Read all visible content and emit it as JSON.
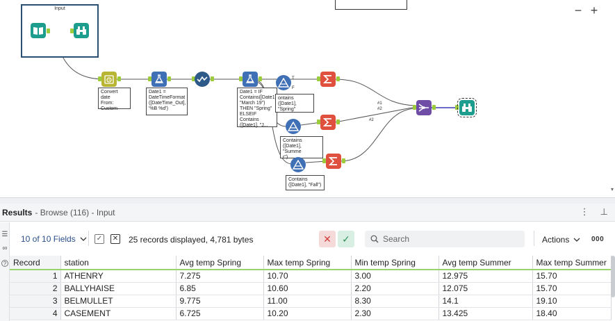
{
  "canvas": {
    "container_title": "Input",
    "zoom_out": "−",
    "zoom_in": "+",
    "annotations": {
      "formula": "Convert date\nFrom:\nCustom",
      "datetime": "Date1 =\nDateTimeFormat\n([DateTime_Out],\n'%B %d')",
      "season": "Date1 = IF\nContains([Date1],\n\"March 19\")\nTHEN \"Spring\"\nELSEIF Contains\n([Date1], \"J...",
      "filter_spring": "ontains\n([Date1], \"Spring\"",
      "filter_summer": "Contains\n([Date1], \"Summe\nr\")",
      "filter_fall": "Contains\n([Date1], \"Fall\")"
    },
    "input_labels": {
      "in1": "#1",
      "in2": "#2",
      "in2b": "#2"
    }
  },
  "results": {
    "title": "Results",
    "subtitle": "- Browse (116) - Input",
    "more_icon": "⋮",
    "pin_icon": "⊥"
  },
  "toolbar": {
    "fields_label": "10 of 10 Fields",
    "records_text": "25 records displayed, 4,781 bytes",
    "search_placeholder": "Search",
    "actions_label": "Actions",
    "more_label": "000"
  },
  "table": {
    "columns": [
      "Record",
      "station",
      "Avg temp Spring",
      "Max temp Spring",
      "Min temp Spring",
      "Avg temp Summer",
      "Max temp Summer"
    ],
    "rows": [
      [
        "1",
        "ATHENRY",
        "7.275",
        "10.70",
        "3.00",
        "12.975",
        "15.70"
      ],
      [
        "2",
        "BALLYHAISE",
        "6.85",
        "10.60",
        "2.20",
        "12.075",
        "15.70"
      ],
      [
        "3",
        "BELMULLET",
        "9.775",
        "11.00",
        "8.30",
        "14.1",
        "19.10"
      ],
      [
        "4",
        "CASEMENT",
        "6.725",
        "10.20",
        "2.30",
        "13.425",
        "18.40"
      ]
    ]
  },
  "colors": {
    "teal": "#1d9d8e",
    "olive": "#b9b534",
    "blue": "#3f6fb5",
    "red": "#e0503e",
    "purple": "#6f4da7",
    "anchor": "#9ccc3c"
  }
}
